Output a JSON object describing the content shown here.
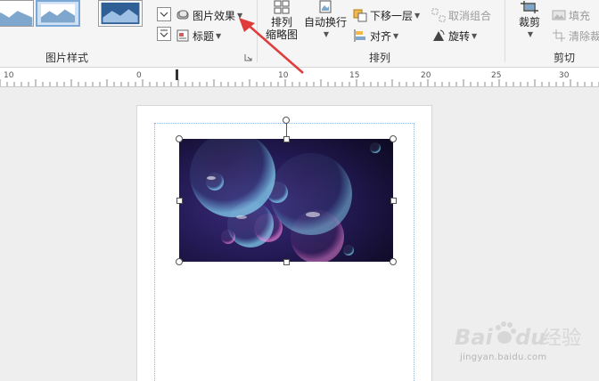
{
  "ribbon": {
    "picture_styles": {
      "label": "图片样式"
    },
    "picture_effects": {
      "label": "图片效果"
    },
    "caption": {
      "label": "标题"
    },
    "arrange": {
      "label": "排列",
      "thumbnail": {
        "line1": "排列",
        "line2": "缩略图"
      },
      "wrap_text": {
        "label": "自动换行"
      },
      "send_backward": {
        "label": "下移一层"
      },
      "align": {
        "label": "对齐"
      },
      "ungroup": {
        "label": "取消组合"
      },
      "rotate": {
        "label": "旋转"
      }
    },
    "crop": {
      "label": "剪切",
      "crop_button": {
        "label": "裁剪"
      },
      "fill": {
        "label": "填充"
      },
      "clear_crop": {
        "label": "清除裁"
      }
    }
  },
  "ruler": {
    "ticks": [
      "10",
      "0",
      "10",
      "15",
      "20",
      "25",
      "30"
    ]
  },
  "watermark": {
    "brand": "Bai",
    "brand_suffix": "du",
    "cn": "经验",
    "url": "jingyan.baidu.com"
  },
  "colors": {
    "arrow": "#e03c3c",
    "selection": "#8fb4e0",
    "picture_bg": "#1a1540"
  }
}
